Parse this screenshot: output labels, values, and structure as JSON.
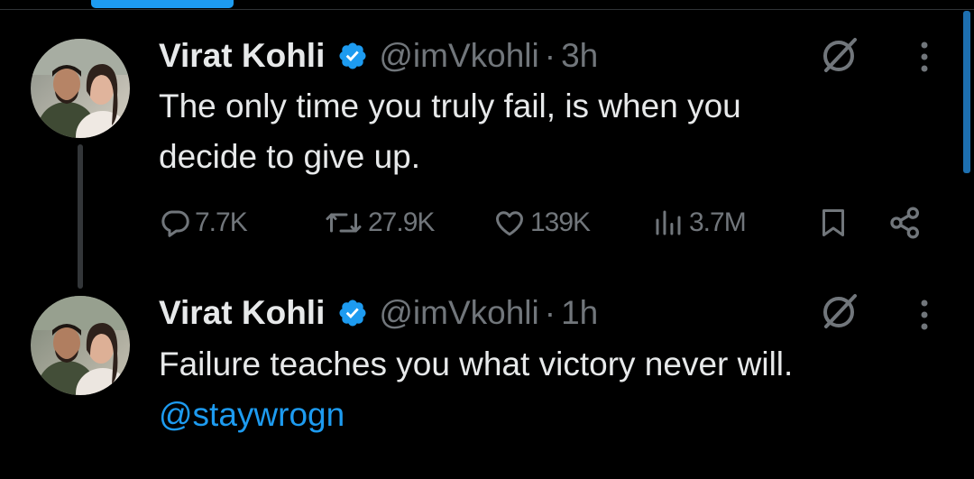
{
  "colors": {
    "accent": "#1d9bf0",
    "muted": "#71767b",
    "text": "#e7e9ea",
    "background": "#000000"
  },
  "tweets": [
    {
      "name": "Virat Kohli",
      "handle": "@imVkohli",
      "separator": "·",
      "time": "3h",
      "lines": [
        "The only time you truly fail, is when you",
        "decide to give up."
      ],
      "stats": {
        "replies": "7.7K",
        "reposts": "27.9K",
        "likes": "139K",
        "views": "3.7M"
      }
    },
    {
      "name": "Virat Kohli",
      "handle": "@imVkohli",
      "separator": "·",
      "time": "1h",
      "line": "Failure teaches you what victory never will.",
      "mention": "@staywrogn"
    }
  ],
  "icons": [
    "verified-badge-icon",
    "grok-icon",
    "more-icon",
    "reply-icon",
    "repost-icon",
    "like-icon",
    "views-icon",
    "bookmark-icon",
    "share-icon"
  ]
}
